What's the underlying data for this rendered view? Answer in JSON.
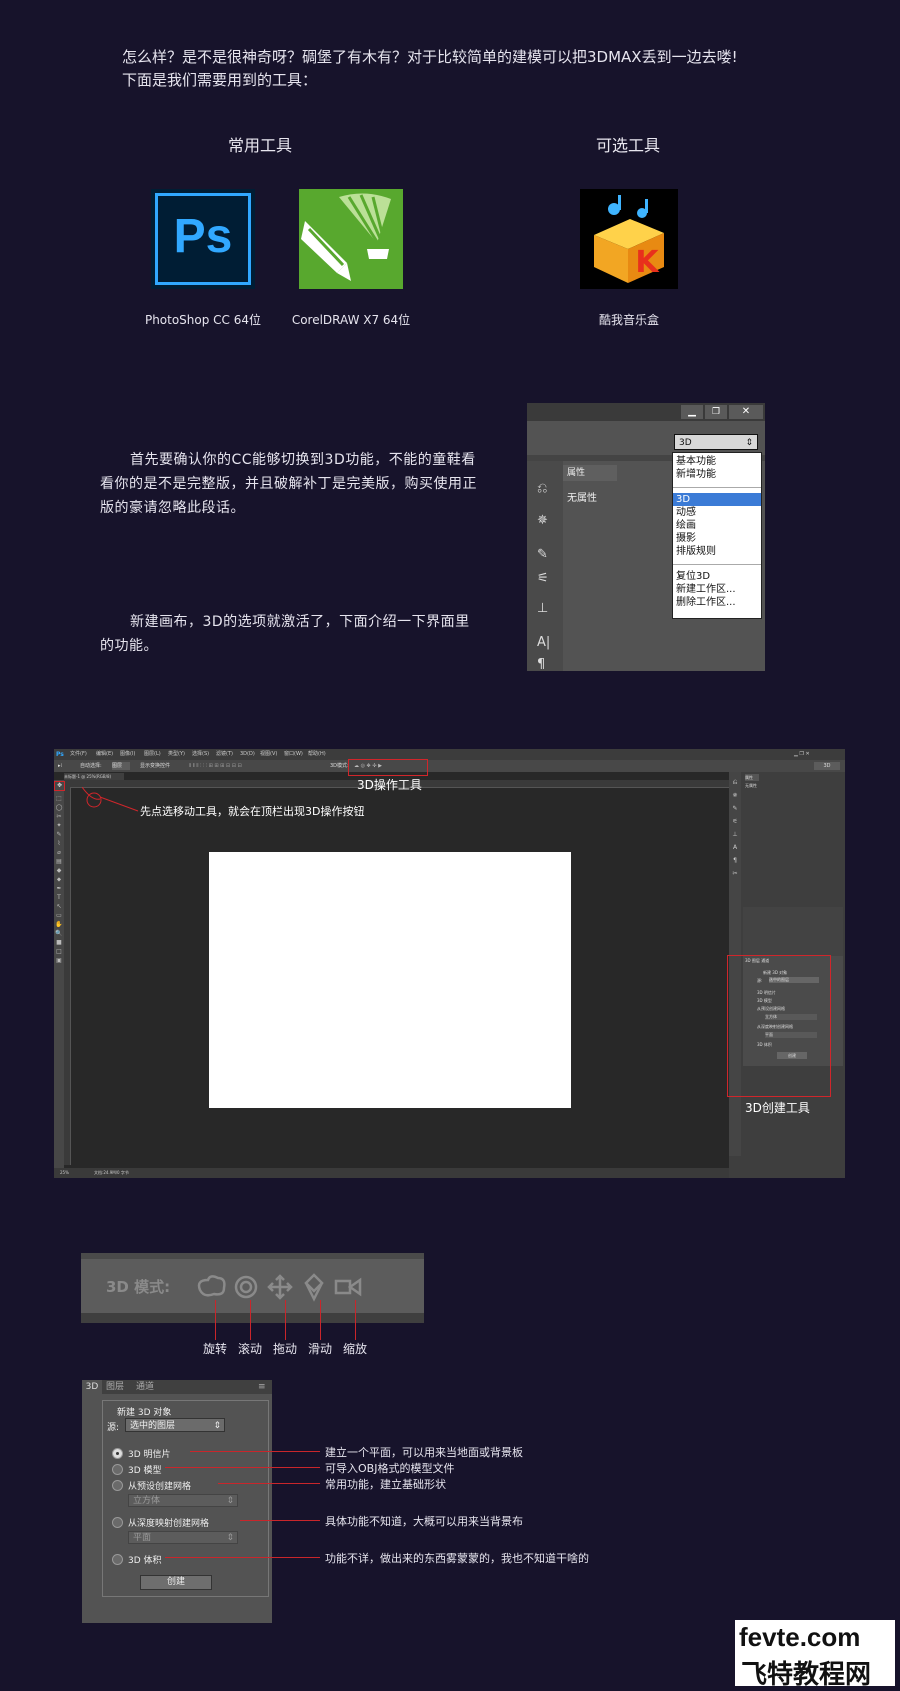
{
  "intro": {
    "line1": "怎么样？是不是很神奇呀？碉堡了有木有？对于比较简单的建模可以把3DMAX丢到一边去喽!",
    "line2": "下面是我们需要用到的工具："
  },
  "tools": {
    "common_title": "常用工具",
    "optional_title": "可选工具",
    "ps_caption": "PhotoShop CC 64位",
    "cdr_caption": "CorelDRAW X7 64位",
    "kuwo_caption": "酷我音乐盒",
    "ps_logo_text": "Ps",
    "kuwo_logo_text": "K"
  },
  "para1": "首先要确认你的CC能够切换到3D功能，不能的童鞋看看你的是不是完整版，并且破解补丁是完美版，购买使用正版的豪请忽略此段话。",
  "para2": "新建画布，3D的选项就激活了，下面介绍一下界面里的功能。",
  "menu_panel": {
    "selected": "3D",
    "items_group1": [
      "基本功能",
      "新增功能"
    ],
    "items_group2": [
      "3D",
      "动感",
      "绘画",
      "摄影",
      "排版规则"
    ],
    "items_group3": [
      "复位3D",
      "新建工作区...",
      "删除工作区..."
    ],
    "panel_tab": "属性",
    "panel_body": "无属性"
  },
  "ps_window": {
    "logo": "Ps",
    "menus": [
      "文件(F)",
      "编辑(E)",
      "图像(I)",
      "图层(L)",
      "类型(Y)",
      "选择(S)",
      "滤镜(T)",
      "3D(D)",
      "视图(V)",
      "窗口(W)",
      "帮助(H)"
    ],
    "doc_tab": "未标题-1 @ 25%(RGB/8)",
    "options_auto": "自动选择:",
    "options_layer": "图层",
    "options_transform": "显示变换控件",
    "options_3dmode": "3D模式:",
    "right_select": "3D",
    "status_zoom": "25%",
    "status_doc": "文档:24.9M/0 字节",
    "label_3d_tools": "3D操作工具",
    "label_create": "3D创建工具",
    "annotation": "先点选移动工具，就会在顶栏出现3D操作按钮",
    "props_tab": "属性",
    "props_body": "无属性",
    "mini_panel": {
      "tabs": [
        "3D",
        "图层",
        "通道"
      ],
      "title": "新建 3D 对象",
      "source_label": "源:",
      "source_value": "选中的图层",
      "options": [
        "3D 明信片",
        "3D 模型",
        "从预设创建网格",
        "从深度映射创建网格",
        "3D 体积"
      ],
      "preset": "立方体",
      "depth": "平面",
      "button": "创建"
    }
  },
  "mode_bar": {
    "label": "3D 模式:",
    "icons": [
      "rotate-icon",
      "roll-icon",
      "drag-icon",
      "slide-icon",
      "scale-icon"
    ],
    "captions": [
      "旋转",
      "滚动",
      "拖动",
      "滑动",
      "缩放"
    ]
  },
  "panel3d": {
    "tabs": [
      "3D",
      "图层",
      "通道"
    ],
    "title": "新建 3D 对象",
    "source_label": "源:",
    "source_value": "选中的图层",
    "options": [
      "3D 明信片",
      "3D 模型",
      "从预设创建网格",
      "从深度映射创建网格",
      "3D 体积"
    ],
    "preset_value": "立方体",
    "depth_value": "平面",
    "create_button": "创建",
    "descriptions": [
      "建立一个平面，可以用来当地面或背景板",
      "可导入OBJ格式的模型文件",
      "常用功能，建立基础形状",
      "具体功能不知道，大概可以用来当背景布",
      "功能不详，做出来的东西雾蒙蒙的，我也不知道干啥的"
    ]
  },
  "watermark": {
    "line1": "fevte.com",
    "line2": "飞特教程网"
  },
  "colors": {
    "background": "#17132b",
    "ps_blue": "#31a8ff",
    "ps_dark": "#001d34",
    "cdr_green": "#58a82e",
    "accent_red": "#d0262b",
    "ui_dark": "#535353"
  }
}
